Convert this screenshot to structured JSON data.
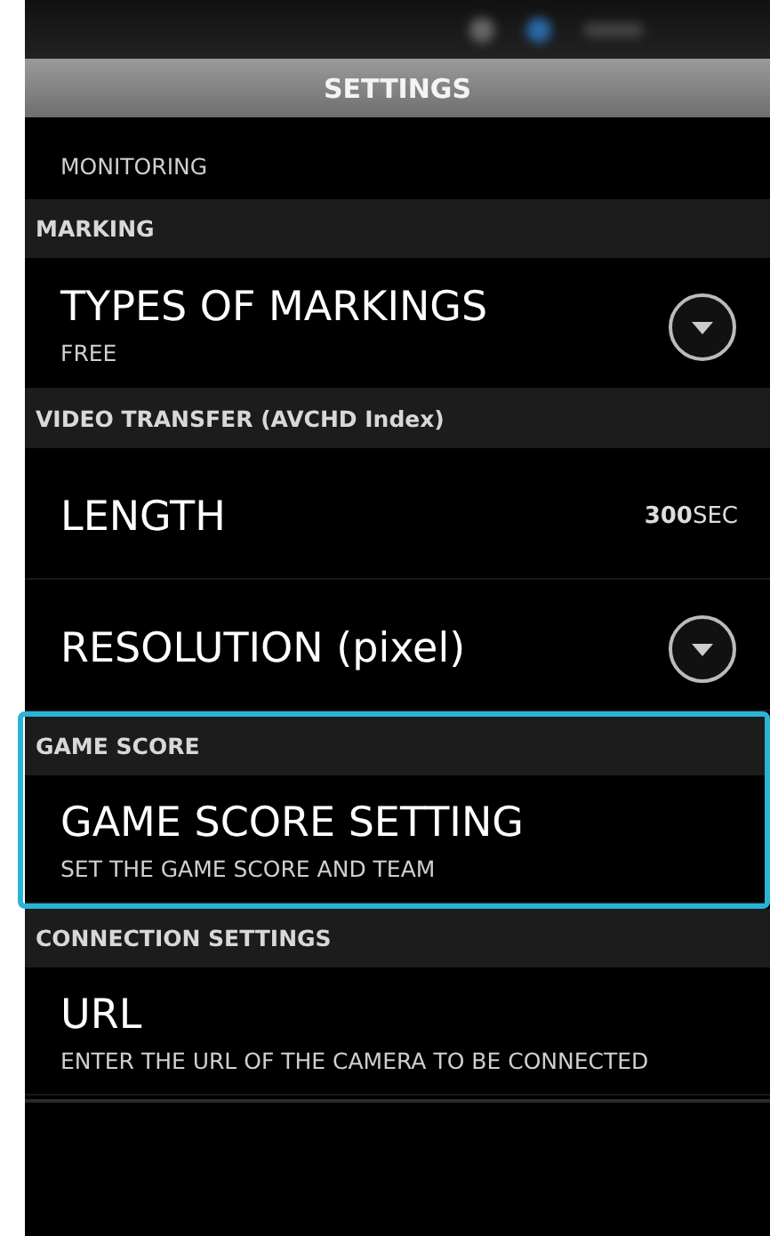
{
  "header": {
    "title": "SETTINGS"
  },
  "top_item": {
    "subtitle": "MONITORING"
  },
  "sections": [
    {
      "title": "MARKING",
      "selected": false,
      "items": [
        {
          "kind": "dropdown",
          "title": "TYPES OF MARKINGS",
          "subtitle": "FREE"
        }
      ]
    },
    {
      "title": "VIDEO TRANSFER (AVCHD Index)",
      "selected": false,
      "items": [
        {
          "kind": "value",
          "title": "LENGTH",
          "value": "**300**SEC"
        },
        {
          "kind": "dropdown",
          "title": "RESOLUTION (pixel)"
        }
      ]
    },
    {
      "title": "GAME SCORE",
      "selected": true,
      "items": [
        {
          "kind": "plain",
          "title": "GAME SCORE SETTING",
          "subtitle": "SET THE GAME SCORE AND TEAM"
        }
      ]
    },
    {
      "title": "CONNECTION SETTINGS",
      "selected": false,
      "items": [
        {
          "kind": "plain",
          "title": "URL",
          "subtitle": "ENTER THE URL OF THE CAMERA TO BE CONNECTED"
        }
      ]
    }
  ]
}
